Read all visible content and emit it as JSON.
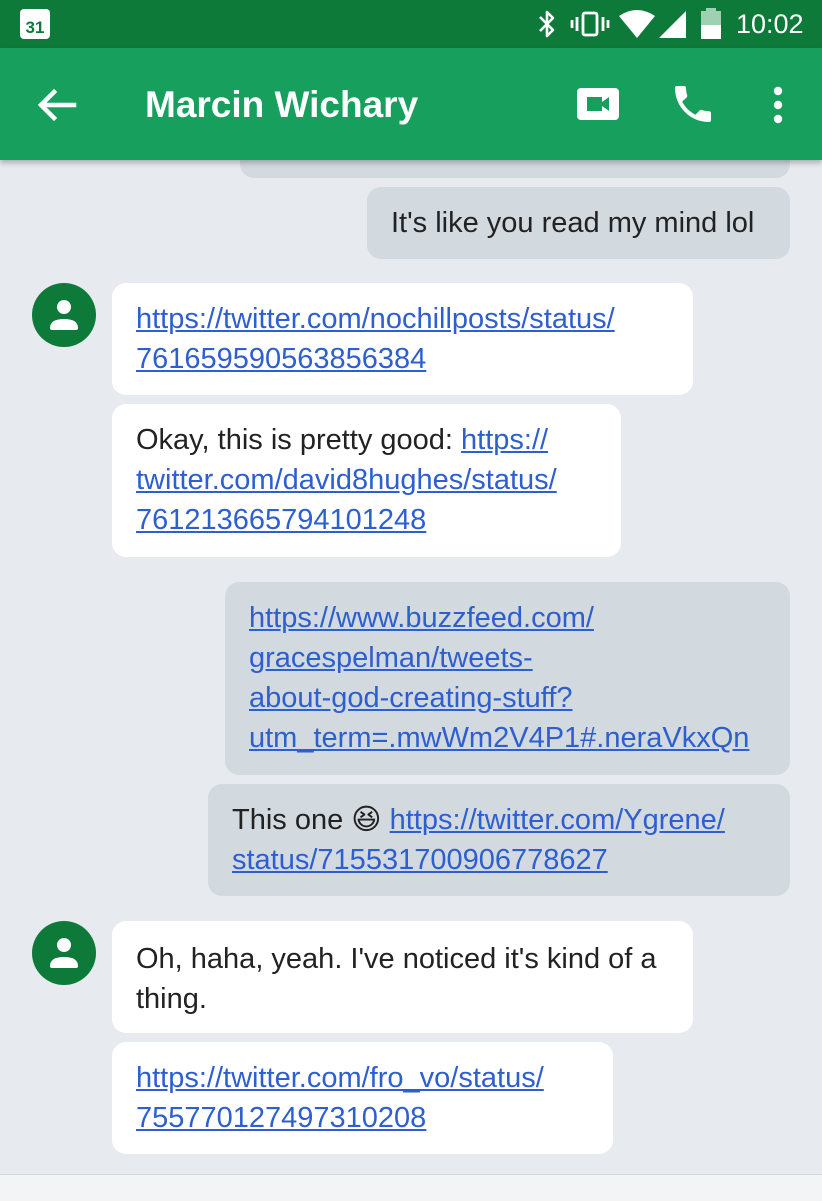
{
  "status_bar": {
    "calendar_day": "31",
    "time": "10:02",
    "icons": [
      "bluetooth-icon",
      "vibrate-icon",
      "wifi-icon",
      "signal-icon",
      "battery-icon"
    ]
  },
  "app_bar": {
    "title": "Marcin Wichary",
    "icons": [
      "back-arrow-icon",
      "video-call-icon",
      "phone-icon",
      "more-vert-icon"
    ]
  },
  "colors": {
    "status_bar": "#0e7a3a",
    "app_bar": "#17a05d",
    "background": "#e7eaee",
    "incoming_bubble": "#ffffff",
    "outgoing_bubble": "#d2d9df",
    "link": "#2d5fd0",
    "avatar": "#0e7a3a"
  },
  "messages": [
    {
      "direction": "out",
      "lines": [
        "It's like you read my mind lol"
      ]
    },
    {
      "direction": "in",
      "avatar": true,
      "lines": [
        "https://twitter.com/nochillposts/status/",
        "761659590563856384"
      ]
    },
    {
      "direction": "in",
      "lines": [
        "Okay, this is pretty good: https://",
        "twitter.com/david8hughes/status/",
        "761213665794101248"
      ]
    },
    {
      "direction": "out",
      "lines": [
        "https://www.buzzfeed.com/",
        "gracespelman/tweets-",
        "about-god-creating-stuff?",
        "utm_term=.mwWm2V4P1#.neraVkxQn"
      ]
    },
    {
      "direction": "out",
      "lines": [
        "This one",
        "https://twitter.com/Ygrene/",
        "status/715531700906778627"
      ]
    },
    {
      "direction": "in",
      "avatar": true,
      "lines": [
        "Oh, haha, yeah. I've noticed it's kind of a",
        "thing."
      ]
    },
    {
      "direction": "in",
      "lines": [
        "https://twitter.com/fro_vo/status/",
        "755770127497310208"
      ]
    }
  ],
  "msg": {
    "m1": "It's like you read my mind lol",
    "m2_l1": "https://twitter.com/nochillposts/status/",
    "m2_l2": "761659590563856384",
    "m3_text": "Okay, this is pretty good: ",
    "m3_l1": "https://",
    "m3_l2": "twitter.com/david8hughes/status/",
    "m3_l3": "761213665794101248",
    "m4_l1": "https://www.buzzfeed.com/",
    "m4_l2": "gracespelman/tweets-",
    "m4_l3": "about-god-creating-stuff?",
    "m4_l4": "utm_term=.mwWm2V4P1#.neraVkxQn",
    "m5_text": "This one",
    "m5_emoji": "😆",
    "m5_l1": "https://twitter.com/Ygrene/",
    "m5_l2": "status/715531700906778627",
    "m6_l1": "Oh, haha, yeah. I've noticed it's kind of a",
    "m6_l2": "thing.",
    "m7_l1": "https://twitter.com/fro_vo/status/",
    "m7_l2": "755770127497310208"
  }
}
